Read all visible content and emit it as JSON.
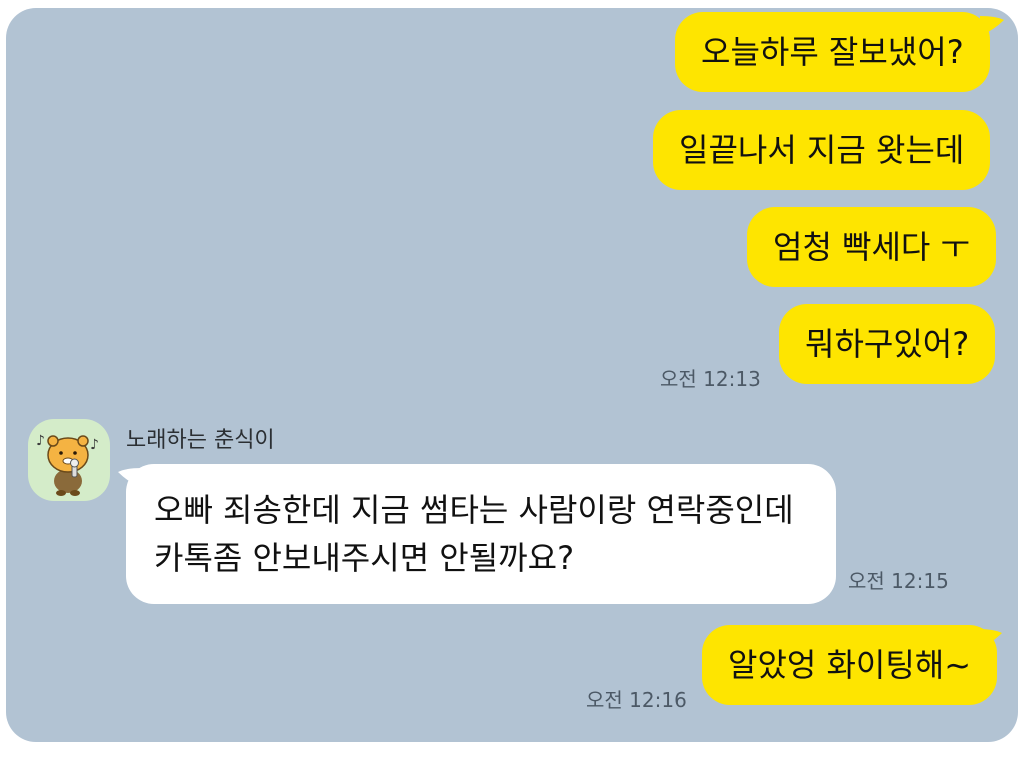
{
  "messages_out_1": [
    {
      "text": "오늘하루 잘보냈어?"
    },
    {
      "text": "일끝나서 지금 왓는데"
    },
    {
      "text": "엄청 빡세다 ㅜ"
    },
    {
      "text": "뭐하구있어?"
    }
  ],
  "time_out_1": "오전 12:13",
  "incoming": {
    "sender_name": "노래하는 춘식이",
    "avatar_icon": "choonsik-singing-icon",
    "line1": "오빠 죄송한데 지금 썸타는 사람이랑 연락중인데",
    "line2": "카톡좀 안보내주시면 안될까요?",
    "time": "오전 12:15"
  },
  "message_out_2": {
    "text": "알았엉 화이팅해~",
    "time": "오전 12:16"
  },
  "colors": {
    "background": "#b2c3d3",
    "my_bubble": "#fee500",
    "their_bubble": "#ffffff"
  }
}
